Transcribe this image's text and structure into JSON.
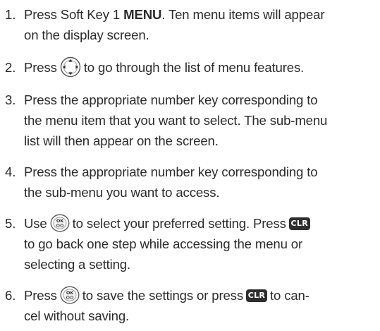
{
  "steps": [
    {
      "number": "1.",
      "text_a": "Press Soft Key 1 ",
      "bold": "MENU",
      "text_b": ". Ten menu items will appear",
      "line2": "on the display screen."
    },
    {
      "number": "2.",
      "text_a": "Press",
      "icon": "navigation-key-icon",
      "text_b": "to go through the list of menu features."
    },
    {
      "number": "3.",
      "line1": "Press the appropriate number key corresponding to",
      "line2": "the menu item that you want to select. The sub-menu",
      "line3": "list will then appear on the screen."
    },
    {
      "number": "4.",
      "line1": "Press the appropriate number key corresponding to",
      "line2": "the sub-menu you want to access."
    },
    {
      "number": "5.",
      "text_a": "Use",
      "icon_ok": "ok-key-icon",
      "text_b": "to select your preferred setting. Press",
      "clr_label": "CLR",
      "line2": "to go back one step while accessing the menu or",
      "line3": "selecting a setting."
    },
    {
      "number": "6.",
      "text_a": "Press",
      "icon_ok": "ok-key-icon",
      "text_b": "to save the settings or press",
      "clr_label": "CLR",
      "text_c": "to can-",
      "line2": "cel without saving."
    }
  ],
  "key_labels": {
    "ok": "OK"
  },
  "colors": {
    "text": "#2b2b2b",
    "key_fill": "#2e2e2e",
    "key_outline": "#555555"
  }
}
